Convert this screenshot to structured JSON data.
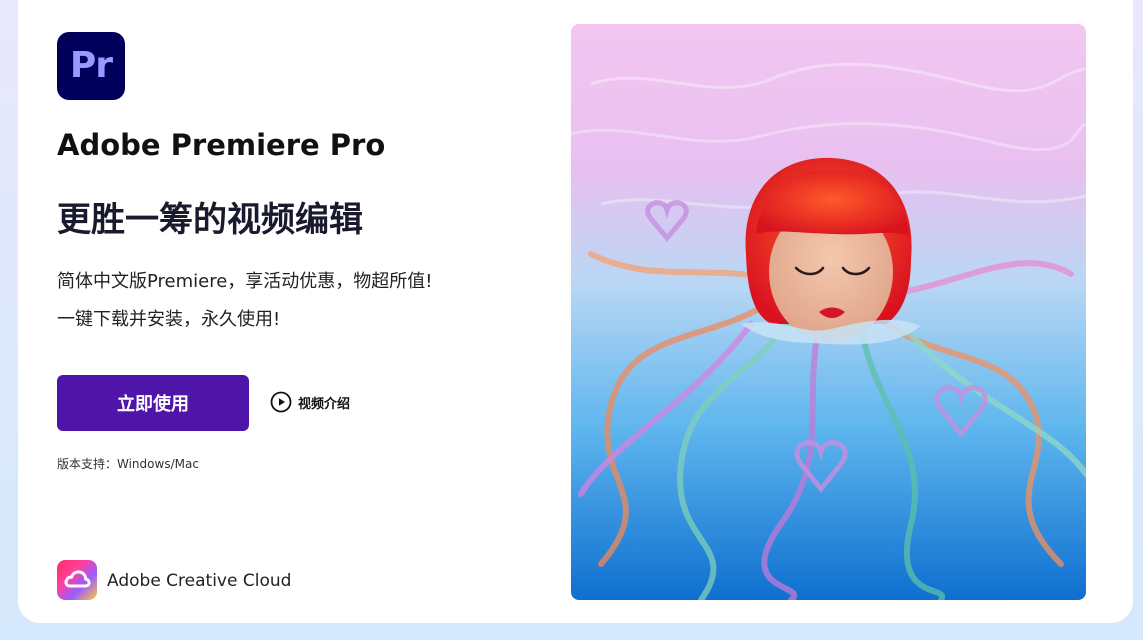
{
  "product": {
    "logo_text": "Pr",
    "name": "Adobe Premiere Pro"
  },
  "headline": "更胜一筹的视频编辑",
  "description": {
    "line1": "简体中文版Premiere，享活动优惠，物超所值!",
    "line2": "一键下载并安装，永久使用!"
  },
  "cta": {
    "primary_label": "立即使用",
    "video_label": "视频介绍"
  },
  "version_support": "版本支持：Windows/Mac",
  "footer": {
    "brand_label": "Adobe Creative Cloud"
  },
  "colors": {
    "cta_background": "#4f14a8",
    "pr_logo_background": "#00005b",
    "pr_logo_text": "#9999ff"
  },
  "icons": {
    "play": "play-circle-icon",
    "creative_cloud": "creative-cloud-logo"
  }
}
